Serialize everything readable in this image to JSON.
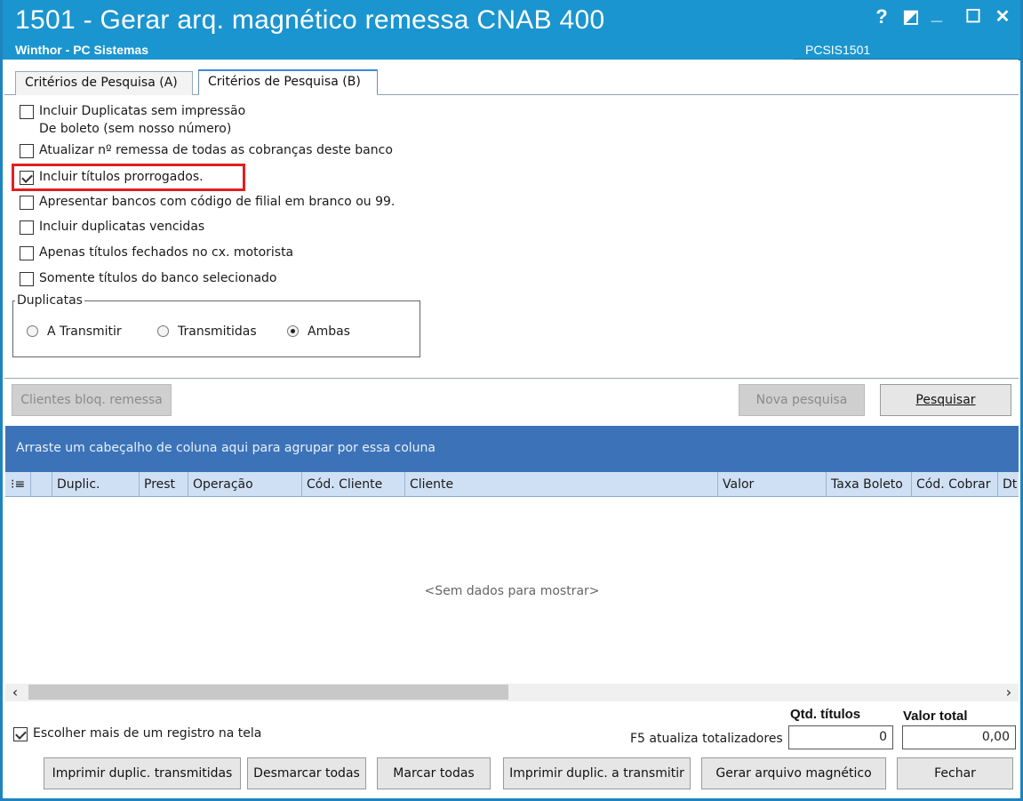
{
  "window": {
    "title": "1501 - Gerar arq. magnético remessa CNAB 400",
    "subtitle": "Winthor - PC Sistemas",
    "code": "PCSIS1501",
    "controls": {
      "help": "?",
      "restore": "◩",
      "minimize": "_",
      "maximize": "☐",
      "close": "✕"
    }
  },
  "tabs": [
    {
      "label": "Critérios de Pesquisa (A)",
      "active": false
    },
    {
      "label": "Critérios de Pesquisa (B)",
      "active": true
    }
  ],
  "options": [
    {
      "label": "Incluir Duplicatas sem impressão",
      "label2": "De boleto (sem nosso número)",
      "checked": false
    },
    {
      "label": "Atualizar nº remessa de todas as cobranças deste banco",
      "checked": false
    },
    {
      "label": "Incluir títulos prorrogados.",
      "checked": true
    },
    {
      "label": "Apresentar bancos com código de filial em branco ou 99.",
      "checked": false
    },
    {
      "label": "Incluir duplicatas vencidas",
      "checked": false
    },
    {
      "label": "Apenas títulos fechados no cx. motorista",
      "checked": false
    },
    {
      "label": "Somente títulos do banco selecionado",
      "checked": false
    }
  ],
  "duplicatas": {
    "title": "Duplicatas",
    "options": [
      {
        "label": "A Transmitir",
        "selected": false
      },
      {
        "label": "Transmitidas",
        "selected": false
      },
      {
        "label": "Ambas",
        "selected": true
      }
    ]
  },
  "actions": {
    "clientes_bloq": "Clientes bloq. remessa",
    "nova_pesquisa": "Nova pesquisa",
    "pesquisar": "Pesquisar"
  },
  "grid": {
    "group_hint": "Arraste um cabeçalho de coluna aqui para agrupar por essa coluna",
    "columns": [
      "Duplic.",
      "Prest",
      "Operação",
      "Cód. Cliente",
      "Cliente",
      "Valor",
      "Taxa Boleto",
      "Cód. Cobrar",
      "Dt"
    ],
    "empty": "<Sem dados para mostrar>"
  },
  "footer": {
    "multi_select_label": "Escolher mais de um registro na tela",
    "multi_select_checked": true,
    "f5_label": "F5 atualiza totalizadores",
    "qtd_label": "Qtd. títulos",
    "qtd_value": "0",
    "valor_label": "Valor total",
    "valor_value": "0,00",
    "buttons": {
      "imprimir_transmitidas": "Imprimir duplic. transmitidas",
      "desmarcar": "Desmarcar todas",
      "marcar": "Marcar todas",
      "imprimir_a_transmitir": "Imprimir duplic. a transmitir",
      "gerar": "Gerar arquivo magnético",
      "fechar": "Fechar"
    }
  },
  "colors": {
    "titlebar": "#1b95cf",
    "groupbar": "#3c73b8",
    "grid_header": "#cfe0f4",
    "highlight": "#e02020"
  }
}
